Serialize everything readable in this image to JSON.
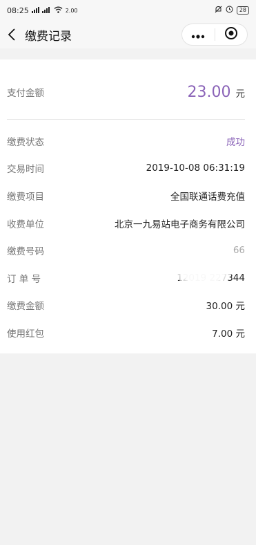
{
  "status_bar": {
    "time": "08:25",
    "signal": "ᵢₗ ᵢₗ",
    "network_speed": "2.00",
    "battery": "28"
  },
  "nav": {
    "title": "缴费记录"
  },
  "payment": {
    "paid_label": "支付金额",
    "paid_value": "23.00",
    "paid_unit": "元"
  },
  "details": [
    {
      "label": "缴费状态",
      "value": "成功"
    },
    {
      "label": "交易时间",
      "value": "2019-10-08 06:31:19"
    },
    {
      "label": "缴费项目",
      "value": "全国联通话费充值"
    },
    {
      "label": "收费单位",
      "value": "北京一九易站电子商务有限公司"
    },
    {
      "label": "缴费号码",
      "value": "66"
    },
    {
      "label": "订 单 号",
      "value": "12019 227344"
    },
    {
      "label": "缴费金额",
      "value": "30.00 元"
    },
    {
      "label": "使用红包",
      "value": "7.00 元"
    }
  ],
  "colors": {
    "accent": "#8b64b8"
  }
}
